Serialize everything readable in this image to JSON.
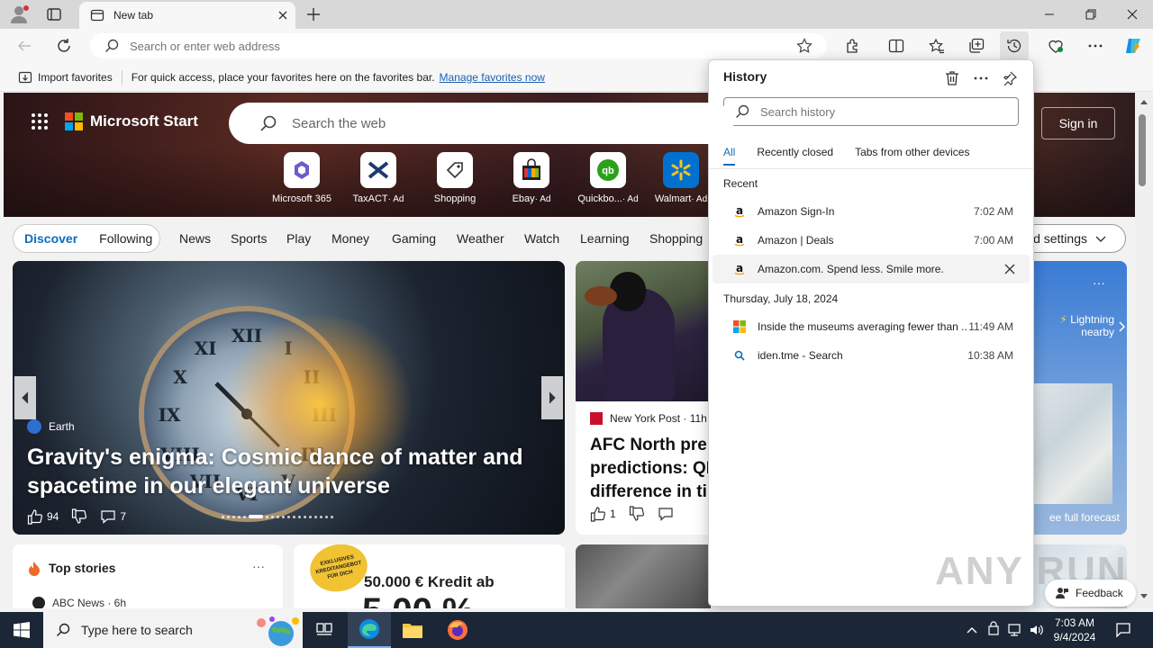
{
  "browser": {
    "tab_title": "New tab",
    "address_placeholder": "Search or enter web address"
  },
  "favorites_bar": {
    "import_label": "Import favorites",
    "message": "For quick access, place your favorites here on the favorites bar.",
    "manage_link": "Manage favorites now"
  },
  "page": {
    "brand": "Microsoft Start",
    "search_placeholder": "Search the web",
    "signin_label": "Sign in",
    "quick_links": [
      {
        "label": "Microsoft 365",
        "ad": ""
      },
      {
        "label": "TaxACT",
        "ad": "· Ad"
      },
      {
        "label": "Shopping",
        "ad": ""
      },
      {
        "label": "Ebay",
        "ad": "· Ad"
      },
      {
        "label": "Quickbo...",
        "ad": "· Ad"
      },
      {
        "label": "Walmart",
        "ad": "· Ad"
      }
    ],
    "feed_tabs": {
      "discover": "Discover",
      "following": "Following"
    },
    "nav_items": [
      "News",
      "Sports",
      "Play",
      "Money",
      "Gaming",
      "Weather",
      "Watch",
      "Learning",
      "Shopping"
    ],
    "settings_label": "ed settings",
    "main_card": {
      "source": "Earth",
      "title": "Gravity's enigma: Cosmic dance of matter and spacetime in our elegant universe",
      "likes": "94",
      "comments": "7"
    },
    "card2": {
      "source": "New York Post · 11h",
      "title": "AFC North pre predictions: QI difference in ti",
      "likes": "1"
    },
    "weather": {
      "more": "···",
      "alert_line1": "Lightning",
      "alert_line2": "nearby",
      "forecast_link": "ee full forecast"
    },
    "top_stories": {
      "title": "Top stories",
      "more": "···",
      "source": "ABC News · 6h"
    },
    "ad": {
      "badge": "EXKLUSIVES KREDITANGEBOT FÜR DICH",
      "headline": "50.000 € Kredit ab",
      "big": "5,00 %"
    },
    "feedback_label": "Feedback",
    "watermark": "ANY RUN"
  },
  "history": {
    "title": "History",
    "search_placeholder": "Search history",
    "tabs": [
      "All",
      "Recently closed",
      "Tabs from other devices"
    ],
    "sections": [
      {
        "label": "Recent",
        "items": [
          {
            "title": "Amazon Sign-In",
            "time": "7:02 AM",
            "icon": "amazon-icon"
          },
          {
            "title": "Amazon | Deals",
            "time": "7:00 AM",
            "icon": "amazon-icon"
          },
          {
            "title": "Amazon.com. Spend less. Smile more.",
            "time": "",
            "icon": "amazon-icon"
          }
        ]
      },
      {
        "label": "Thursday, July 18, 2024",
        "items": [
          {
            "title": "Inside the museums averaging fewer than ...",
            "time": "11:49 AM",
            "icon": "microsoft-icon"
          },
          {
            "title": "iden.tme - Search",
            "time": "10:38 AM",
            "icon": "search-icon"
          }
        ]
      }
    ]
  },
  "taskbar": {
    "search_placeholder": "Type here to search",
    "time": "7:03 AM",
    "date": "9/4/2024"
  }
}
